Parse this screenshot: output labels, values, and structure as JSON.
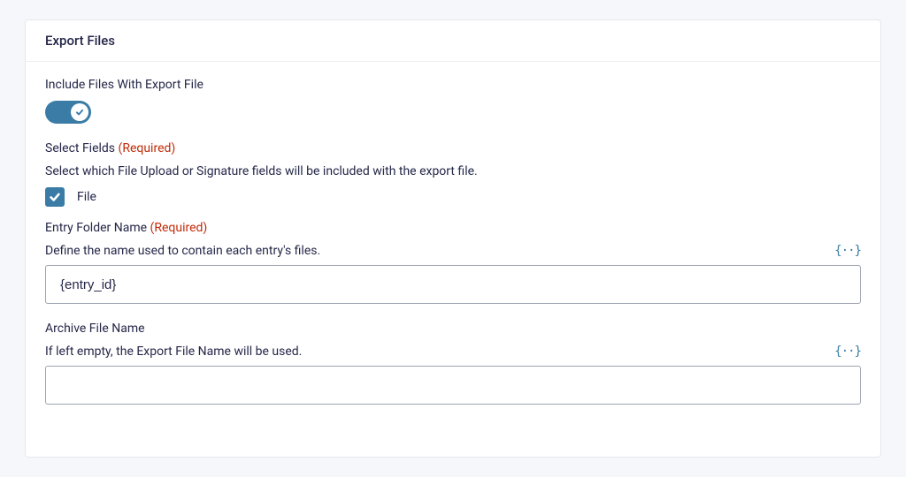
{
  "card": {
    "title": "Export Files"
  },
  "toggle": {
    "label": "Include Files With Export File",
    "state": "on"
  },
  "selectFields": {
    "label": "Select Fields",
    "required_text": "(Required)",
    "helper": "Select which File Upload or Signature fields will be included with the export file.",
    "options": [
      {
        "label": "File",
        "checked": true
      }
    ]
  },
  "entryFolder": {
    "label": "Entry Folder Name",
    "required_text": "(Required)",
    "helper": "Define the name used to contain each entry's files.",
    "value": "{entry_id}"
  },
  "archive": {
    "label": "Archive File Name",
    "helper": "If left empty, the Export File Name will be used.",
    "value": ""
  },
  "icons": {
    "merge_tag": "{··}"
  }
}
